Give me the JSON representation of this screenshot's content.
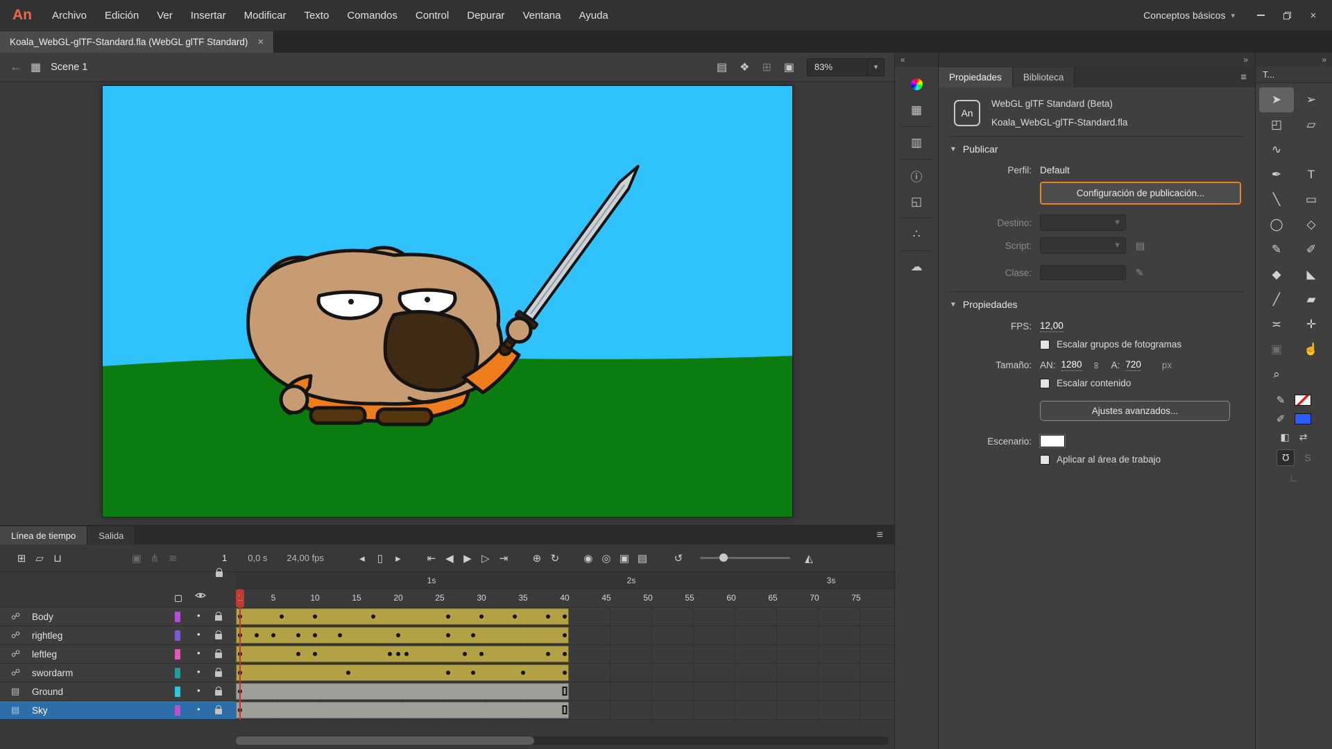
{
  "app": {
    "logo_text": "An",
    "menu_items": [
      "Archivo",
      "Edición",
      "Ver",
      "Insertar",
      "Modificar",
      "Texto",
      "Comandos",
      "Control",
      "Depurar",
      "Ventana",
      "Ayuda"
    ],
    "workspace_label": "Conceptos básicos",
    "workspace_caret": "▾",
    "close_glyph": "×"
  },
  "document_tab": {
    "title": "Koala_WebGL-glTF-Standard.fla (WebGL glTF Standard)",
    "close_glyph": "×"
  },
  "edit_bar": {
    "back_glyph": "←",
    "clapper_glyph": "▦",
    "scene_name": "Scene 1",
    "icons": {
      "edit_scene": "▤",
      "edit_symbols": "❖",
      "stage_grid": "⊞",
      "stage_center": "▣"
    },
    "zoom_value": "83%",
    "zoom_caret": "▾"
  },
  "stage": {
    "colors": {
      "sky": "#2fc2fc",
      "ground": "#0b7c10",
      "fur": "#c79c72",
      "shirt": "#ef7d1b",
      "nose": "#3f2a14",
      "pants": "#54350f",
      "blade": "#ccd1d6"
    }
  },
  "ui_colors": {
    "accent": "#e8831d",
    "tween": "#b3a145",
    "selected_row": "#2d6ea8",
    "fill_blue": "#2e5bff",
    "playhead": "#c03a33"
  },
  "timeline": {
    "panel_tabs": [
      "Línea de tiempo",
      "Salida"
    ],
    "menu_glyph": "≡",
    "controls": {
      "current_frame": "1",
      "elapsed_time": "0,0 s",
      "frame_rate": "24,00 fps"
    },
    "ruler": {
      "numbers": [
        1,
        5,
        10,
        15,
        20,
        25,
        30,
        35,
        40,
        45,
        50,
        55,
        60,
        65,
        70,
        75
      ],
      "seconds": [
        {
          "label": "1s",
          "frame": 24
        },
        {
          "label": "2s",
          "frame": 48
        },
        {
          "label": "3s",
          "frame": 72
        }
      ],
      "playhead_frame": 1
    },
    "layers": [
      {
        "name": "Body",
        "icon": "rig",
        "icon_glyph": "☍",
        "color": "#b44fd8",
        "locked": true,
        "selected": false,
        "span": {
          "type": "tween",
          "start": 1,
          "end": 40
        },
        "keyframes": [
          1,
          6,
          10,
          17,
          26,
          30,
          34,
          38,
          40
        ]
      },
      {
        "name": "rightleg",
        "icon": "rig",
        "icon_glyph": "☍",
        "color": "#7d58d8",
        "locked": true,
        "selected": false,
        "span": {
          "type": "tween",
          "start": 1,
          "end": 40
        },
        "keyframes": [
          1,
          3,
          5,
          8,
          10,
          13,
          20,
          26,
          29,
          40
        ]
      },
      {
        "name": "leftleg",
        "icon": "rig",
        "icon_glyph": "☍",
        "color": "#e558b8",
        "locked": true,
        "selected": false,
        "span": {
          "type": "tween",
          "start": 1,
          "end": 40
        },
        "keyframes": [
          1,
          8,
          10,
          19,
          20,
          21,
          28,
          30,
          38,
          40
        ]
      },
      {
        "name": "swordarm",
        "icon": "rig",
        "icon_glyph": "☍",
        "color": "#1f9e98",
        "locked": true,
        "selected": false,
        "span": {
          "type": "tween",
          "start": 1,
          "end": 40
        },
        "keyframes": [
          1,
          14,
          26,
          29,
          35,
          40
        ]
      },
      {
        "name": "Ground",
        "icon": "layer",
        "icon_glyph": "▤",
        "color": "#2fc7de",
        "locked": true,
        "selected": false,
        "span": {
          "type": "static",
          "start": 1,
          "end": 40
        },
        "keyframes": [
          1
        ]
      },
      {
        "name": "Sky",
        "icon": "layer",
        "icon_glyph": "▤",
        "color": "#c04fd8",
        "locked": true,
        "selected": true,
        "span": {
          "type": "static",
          "start": 1,
          "end": 40
        },
        "keyframes": [
          1
        ]
      }
    ]
  },
  "timeline_icons": {
    "menu": "≡",
    "new_layer": "⊞",
    "new_folder": "▱",
    "delete": "⊔",
    "camera": "▣",
    "parenting": "⋔",
    "layer_depth": "≋",
    "step_back": "◂",
    "frame_box": "▯",
    "step_forward": "▸",
    "first": "⇤",
    "prev": "◀",
    "play": "▶",
    "next": "▷",
    "last": "⇥",
    "center_frame": "⊕",
    "loop": "↻",
    "onion_skin": "◉",
    "onion_outline": "◎",
    "edit_multiple": "▣",
    "marker_options": "▤",
    "reset": "↺",
    "fit": "◭"
  },
  "dock_strip": {
    "collapse_glyph": "«",
    "panels": [
      {
        "name": "color",
        "wheel": true,
        "sep_after": false
      },
      {
        "name": "swatches",
        "glyph": "▦",
        "sep_after": true
      },
      {
        "name": "align",
        "glyph": "▥",
        "sep_after": true
      },
      {
        "name": "info",
        "glyph": "ⓘ",
        "sep_after": false
      },
      {
        "name": "transform",
        "glyph": "◱",
        "sep_after": true
      },
      {
        "name": "components",
        "glyph": "∴",
        "sep_after": true
      },
      {
        "name": "cc-libraries",
        "glyph": "☁",
        "sep_after": false
      }
    ]
  },
  "properties_panel": {
    "collapse_glyph": "»",
    "tabs": [
      "Propiedades",
      "Biblioteca"
    ],
    "menu_glyph": "≡",
    "doc_badge": "An",
    "doc_type": "WebGL glTF Standard (Beta)",
    "doc_name": "Koala_WebGL-glTF-Standard.fla",
    "publish": {
      "triangle": "▼",
      "title": "Publicar",
      "perfil_label": "Perfil:",
      "perfil_value": "Default",
      "publish_button": "Configuración de publicación...",
      "destino_label": "Destino:",
      "script_label": "Script:",
      "clase_label": "Clase:",
      "dropdown_caret": "▼",
      "script_icon": "▤",
      "clase_icon": "✎"
    },
    "props": {
      "triangle": "▼",
      "title": "Propiedades",
      "fps_label": "FPS:",
      "fps_value": "12,00",
      "scale_frames_label": "Escalar grupos de fotogramas",
      "tamano_label": "Tamaño:",
      "an_label": "AN:",
      "an_value": "1280",
      "link_glyph": "∞",
      "a_label": "A:",
      "a_value": "720",
      "px_label": "px",
      "scale_content_label": "Escalar contenido",
      "advanced_button": "Ajustes avanzados...",
      "escenario_label": "Escenario:",
      "apply_label": "Aplicar al área de trabajo"
    }
  },
  "tools_panel": {
    "title": "T...",
    "collapse_glyph": "»",
    "tools": [
      {
        "name": "selection-tool",
        "glyph": "➤",
        "active": true
      },
      {
        "name": "subselection-tool",
        "glyph": "➢"
      },
      {
        "name": "free-transform-tool",
        "glyph": "◰"
      },
      {
        "name": "gradient-transform-tool",
        "glyph": "▱"
      },
      {
        "name": "lasso-tool",
        "glyph": "∿"
      },
      null,
      {
        "name": "pen-tool",
        "glyph": "✒"
      },
      {
        "name": "text-tool",
        "glyph": "T"
      },
      {
        "name": "line-tool",
        "glyph": "╲"
      },
      {
        "name": "rectangle-tool",
        "glyph": "▭"
      },
      {
        "name": "oval-tool",
        "glyph": "◯"
      },
      {
        "name": "polystar-tool",
        "glyph": "◇"
      },
      {
        "name": "pencil-tool",
        "glyph": "✎"
      },
      {
        "name": "brush-tool",
        "glyph": "✐"
      },
      {
        "name": "ink-bottle-tool",
        "glyph": "◆"
      },
      {
        "name": "paint-bucket-tool",
        "glyph": "◣"
      },
      {
        "name": "eyedropper-tool",
        "glyph": "╱"
      },
      {
        "name": "eraser-tool",
        "glyph": "▰"
      },
      {
        "name": "width-tool",
        "glyph": "≍"
      },
      {
        "name": "asset-warp-tool",
        "glyph": "✛"
      },
      {
        "name": "camera-tool",
        "glyph": "▣",
        "disabled": true
      },
      {
        "name": "hand-tool",
        "glyph": "☝"
      },
      {
        "name": "zoom-tool",
        "glyph": "⌕"
      },
      null
    ],
    "color_controls": {
      "stroke_icon": "✎",
      "fill_icon": "✐",
      "default_glyph": "◧",
      "swap_glyph": "⇄",
      "magnet_glyph": "Ω",
      "bone_glyph": "S",
      "corner_glyph": "∟",
      "fill_color": "#2e5bff"
    }
  }
}
